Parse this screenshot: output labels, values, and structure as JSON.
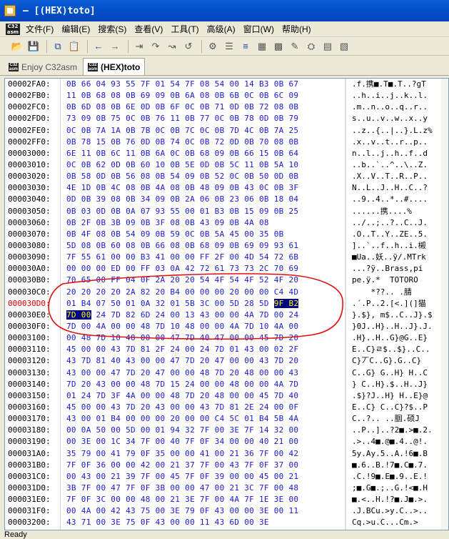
{
  "window": {
    "title": "— [(HEX)toto]"
  },
  "menu": {
    "logo": "C32 asm",
    "items": [
      "文件(F)",
      "编辑(E)",
      "搜索(S)",
      "查看(V)",
      "工具(T)",
      "高级(A)",
      "窗口(W)",
      "帮助(H)"
    ]
  },
  "toolbar": {
    "icons": [
      "open-folder-icon",
      "save-icon",
      "copy-icon",
      "paste-icon",
      "back-arrow-icon",
      "forward-arrow-icon",
      "goto-icon",
      "step-icon",
      "search-icon",
      "replace-icon",
      "bookmark-icon",
      "list-icon",
      "align-icon",
      "hex-icon",
      "sdk-icon",
      "edit-icon",
      "plugin-icon",
      "grid-icon",
      "table-icon"
    ]
  },
  "tabs": [
    {
      "label": "Enjoy C32asm",
      "active": false
    },
    {
      "label": "(HEX)toto",
      "active": true
    }
  ],
  "hex_view": {
    "highlight_address": "000030D0:",
    "selection_color": "#000080",
    "rows": [
      {
        "addr": "00002FA0:",
        "hex": "0B 66 04 93 55 7F 01 54 7F 08 54 00 14 B3 0B 67",
        "ascii": ".f.携■.T■.T..?gT"
      },
      {
        "addr": "00002FB0:",
        "hex": "11 0B 68 08 0B 69 09 0B 6A 08 0B 6B 0C 0B 6C 09",
        "ascii": "..h..i..j..k..l."
      },
      {
        "addr": "00002FC0:",
        "hex": "0B 6D 08 0B 6E 0D 0B 6F 0C 0B 71 0D 0B 72 08 0B",
        "ascii": ".m..n..o..q..r.."
      },
      {
        "addr": "00002FD0:",
        "hex": "73 09 0B 75 0C 0B 76 11 0B 77 0C 0B 78 0D 0B 79",
        "ascii": "s..u..v..w..x..y"
      },
      {
        "addr": "00002FE0:",
        "hex": "0C 0B 7A 1A 0B 7B 0C 0B 7C 0C 0B 7D 4C 0B 7A 25",
        "ascii": "..z..{..|..}.L.z%"
      },
      {
        "addr": "00002FF0:",
        "hex": "0B 78 15 0B 76 0D 0B 74 0C 0B 72 0D 0B 70 08 0B",
        "ascii": ".x..v..t..r..p.."
      },
      {
        "addr": "00003000:",
        "hex": "6E 11 0B 6C 11 0B 6A 0C 0B 68 09 0B 66 15 0B 64",
        "ascii": "n..l..j..h..f..d"
      },
      {
        "addr": "00003010:",
        "hex": "0C 0B 62 0D 0B 60 10 0B 5E 0D 0B 5C 11 0B 5A 10",
        "ascii": "..b..`..^..\\..Z."
      },
      {
        "addr": "00003020:",
        "hex": "0B 58 0D 0B 56 08 0B 54 09 0B 52 0C 0B 50 0D 0B",
        "ascii": ".X..V..T..R..P.."
      },
      {
        "addr": "00003030:",
        "hex": "4E 1D 0B 4C 08 0B 4A 08 0B 48 09 0B 43 0C 0B 3F",
        "ascii": "N..L..J..H..C..?"
      },
      {
        "addr": "00003040:",
        "hex": "0D 0B 39 08 0B 34 09 0B 2A 06 0B 23 06 0B 18 04",
        "ascii": "..9..4..*..#...."
      },
      {
        "addr": "00003050:",
        "hex": "0B 03 0D 0B 0A 07 93 55 00 01 B3 0B 15 09 0B 25",
        "ascii": "......携....%"
      },
      {
        "addr": "00003060:",
        "hex": "0B 2F 0B 3B 09 0B 3F 08 0B 43 09 0B 4A 08",
        "ascii": "../..;..?..C..J."
      },
      {
        "addr": "00003070:",
        "hex": "0B 4F 08 0B 54 09 0B 59 0C 0B 5A 45 00 35 0B",
        "ascii": ".O..T..Y..ZE..5."
      },
      {
        "addr": "00003080:",
        "hex": "5D 08 0B 60 08 0B 66 08 0B 68 09 0B 69 09 93 61",
        "ascii": "]..`..f..h..i.樧"
      },
      {
        "addr": "00003090:",
        "hex": "7F 55 61 00 00 B3 41 00 00 FF 2F 00 4D 54 72 6B",
        "ascii": "■Ua..妖..ÿ/.MTrk"
      },
      {
        "addr": "000030A0:",
        "hex": "00 00 00 ED 00 FF 03 0A 42 72 61 73 73 2C 70 69",
        "ascii": "...?ÿ..Brass,pi"
      },
      {
        "addr": "000030B0:",
        "hex": "70 65 00 FF 04 0F 2A 20 20 54 4F 54 4F 52 4F 20",
        "ascii": "pe.ÿ.*  TOTORO "
      },
      {
        "addr": "000030C0:",
        "hex": "20 20 20 20 2A 82 20 B4 00 00 00 20 00 00 C4 4D",
        "ascii": "    *??.. .腈"
      },
      {
        "addr": "000030D0:",
        "hex": "01 B4 07 50 01 0A 32 01 5B 3C 00 5D 28 5D 9F B2",
        "ascii": ".´.P..2.[<.](]猫"
      },
      {
        "addr": "000030E0:",
        "hex": "7D 00 24 7D 82 6D 24 00 13 43 00 00 4A 7D 00 24",
        "ascii": "}.$}, m$..C..J}.$"
      },
      {
        "addr": "000030F0:",
        "hex": "7D 00 4A 00 00 48 7D 10 48 00 00 4A 7D 10 4A 00",
        "ascii": "}0J..H}..H..J}.J."
      },
      {
        "addr": "00003100:",
        "hex": "00 48 7D 10 48 00 00 47 7D 40 47 00 00 45 7D 20",
        "ascii": ".H}..H..G}@G..E}"
      },
      {
        "addr": "00003110:",
        "hex": "45 00 00 43 7D 81 2F 24 00 24 7D 01 43 00 02 2F",
        "ascii": "E..C}ㄹ$..$}..C.."
      },
      {
        "addr": "00003120:",
        "hex": "43 7D 81 40 43 00 00 47 7D 20 47 00 00 43 7D 20",
        "ascii": "C}丆C..G}.G..C}"
      },
      {
        "addr": "00003130:",
        "hex": "43 00 00 47 7D 20 47 00 00 48 7D 20 48 00 00 43",
        "ascii": "C..G} G..H} H..C"
      },
      {
        "addr": "00003140:",
        "hex": "7D 20 43 00 00 48 7D 15 24 00 00 48 00 00 4A 7D",
        "ascii": "} C..H}.$..H..J}"
      },
      {
        "addr": "00003150:",
        "hex": "01 24 7D 3F 4A 00 00 48 7D 20 48 00 00 45 7D 40",
        "ascii": ".$}?J..H} H..E}@"
      },
      {
        "addr": "00003160:",
        "hex": "45 00 00 43 7D 20 43 00 00 43 7D 81 2E 24 00 0F",
        "ascii": "E..C} C..C}?$..P"
      },
      {
        "addr": "00003170:",
        "hex": "43 00 01 B4 00 00 00 20 00 00 C4 5C 01 B4 5B 4A",
        "ascii": "C..?.. ..腘.硕J"
      },
      {
        "addr": "00003180:",
        "hex": "00 0A 50 00 5D 00 01 94 32 7F 00 3E 7F 14 32 00",
        "ascii": "..P..]..?2■.>■.2."
      },
      {
        "addr": "00003190:",
        "hex": "00 3E 00 1C 34 7F 00 40 7F 0F 34 00 00 40 21 00",
        "ascii": ".>..4■.@■.4..@!."
      },
      {
        "addr": "000031A0:",
        "hex": "35 79 00 41 79 0F 35 00 00 41 00 21 36 7F 00 42",
        "ascii": "5y.Ay.5..A.!6■.B"
      },
      {
        "addr": "000031B0:",
        "hex": "7F 0F 36 00 00 42 00 21 37 7F 00 43 7F 0F 37 00",
        "ascii": "■.6..B.!7■.C■.7."
      },
      {
        "addr": "000031C0:",
        "hex": "00 43 00 21 39 7F 00 45 7F 0F 39 00 00 45 00 21",
        "ascii": ".C.!9■.E■.9..E.!"
      },
      {
        "addr": "000031D0:",
        "hex": "3B 7F 00 47 7F 0F 3B 00 00 47 00 21 3C 7F 00 48",
        "ascii": ";■.G■.;..G.!<■.H"
      },
      {
        "addr": "000031E0:",
        "hex": "7F 0F 3C 00 00 48 00 21 3E 7F 00 4A 7F 1E 3E 00",
        "ascii": "■.<..H.!?■.J■.>."
      },
      {
        "addr": "000031F0:",
        "hex": "00 4A 00 42 43 75 00 3E 79 0F 43 00 00 3E 00 11",
        "ascii": ".J.BCu.>y.C..>.."
      },
      {
        "addr": "00003200:",
        "hex": "43 71 00 3E 75 0F 43 00 00 11 43 6D 00 3E",
        "ascii": "Cq.>u.C...Cm.>"
      }
    ]
  },
  "status": {
    "text": "Ready"
  }
}
